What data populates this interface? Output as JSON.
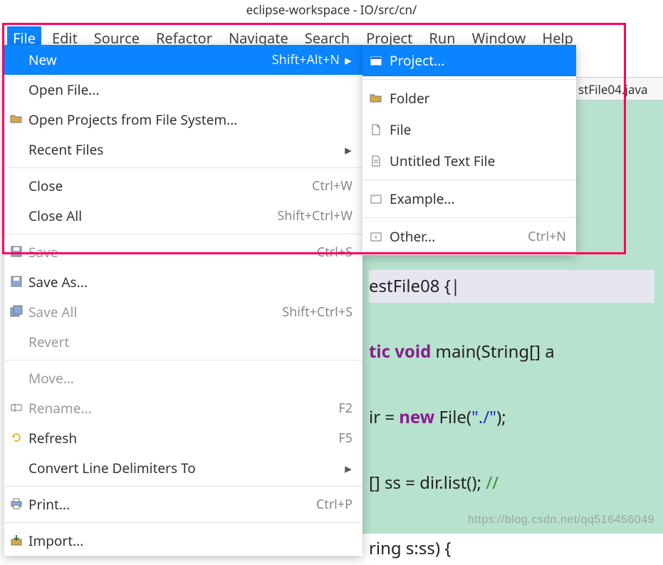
{
  "window": {
    "title": "eclipse-workspace - IO/src/cn/"
  },
  "menubar": {
    "items": [
      {
        "label": "File",
        "open": true
      },
      {
        "label": "Edit"
      },
      {
        "label": "Source"
      },
      {
        "label": "Refactor"
      },
      {
        "label": "Navigate"
      },
      {
        "label": "Search"
      },
      {
        "label": "Project"
      },
      {
        "label": "Run"
      },
      {
        "label": "Window"
      },
      {
        "label": "Help"
      }
    ]
  },
  "file_menu": {
    "items": [
      {
        "label": "New",
        "accel": "Shift+Alt+N",
        "submenu": true,
        "highlight": true,
        "icon": ""
      },
      {
        "label": "Open File...",
        "icon": ""
      },
      {
        "label": "Open Projects from File System...",
        "icon": "folder"
      },
      {
        "label": "Recent Files",
        "submenu": true,
        "icon": ""
      },
      {
        "sep": true
      },
      {
        "label": "Close",
        "accel": "Ctrl+W"
      },
      {
        "label": "Close All",
        "accel": "Shift+Ctrl+W"
      },
      {
        "sep": true
      },
      {
        "label": "Save",
        "accel": "Ctrl+S",
        "disabled": true,
        "icon": "disk"
      },
      {
        "label": "Save As...",
        "icon": "disk"
      },
      {
        "label": "Save All",
        "accel": "Shift+Ctrl+S",
        "disabled": true,
        "icon": "disks"
      },
      {
        "label": "Revert",
        "disabled": true
      },
      {
        "sep": true
      },
      {
        "label": "Move...",
        "disabled": true
      },
      {
        "label": "Rename...",
        "accel": "F2",
        "disabled": true,
        "icon": "rename"
      },
      {
        "label": "Refresh",
        "accel": "F5",
        "icon": "refresh"
      },
      {
        "label": "Convert Line Delimiters To",
        "submenu": true
      },
      {
        "sep": true
      },
      {
        "label": "Print...",
        "accel": "Ctrl+P",
        "icon": "print"
      },
      {
        "sep": true
      },
      {
        "label": "Import...",
        "icon": "import"
      }
    ]
  },
  "new_menu": {
    "items": [
      {
        "label": "Project...",
        "highlight": true,
        "icon": "project"
      },
      {
        "sep": true
      },
      {
        "label": "Folder",
        "icon": "folder"
      },
      {
        "label": "File",
        "icon": "file"
      },
      {
        "label": "Untitled Text File",
        "icon": "text"
      },
      {
        "sep": true
      },
      {
        "label": "Example...",
        "icon": "example"
      },
      {
        "sep": true
      },
      {
        "label": "Other...",
        "accel": "Ctrl+N",
        "icon": "other"
      }
    ]
  },
  "tab": {
    "label": "stFile04.java"
  },
  "editor_fragments": {
    "l1a": "estFile08 {",
    "l2a": "tic ",
    "l2b": "void",
    "l2c": " main(String[] a",
    "l3a": "ir = ",
    "l3b": "new",
    "l3c": " File(",
    "l3d": "\"./\"",
    "l3e": ");",
    "l4a": "[] ss = dir.list(); ",
    "l4b": "// ",
    "l5a": "ring s:ss) {"
  },
  "watermark": "https://blog.csdn.net/qq516456049"
}
